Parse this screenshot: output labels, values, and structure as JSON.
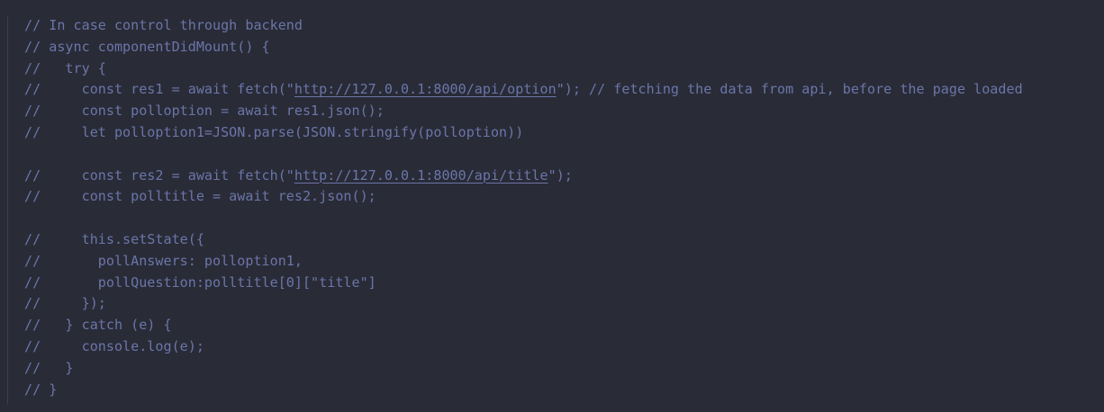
{
  "editor": {
    "lines": [
      {
        "before": "// In case control through backend",
        "url": "",
        "after": ""
      },
      {
        "before": "// async componentDidMount() {",
        "url": "",
        "after": ""
      },
      {
        "before": "//   try {",
        "url": "",
        "after": ""
      },
      {
        "before": "//     const res1 = await fetch(\"",
        "url": "http://127.0.0.1:8000/api/option",
        "after": "\"); // fetching the data from api, before the page loaded"
      },
      {
        "before": "//     const polloption = await res1.json();",
        "url": "",
        "after": ""
      },
      {
        "before": "//     let polloption1=JSON.parse(JSON.stringify(polloption))",
        "url": "",
        "after": ""
      },
      {
        "before": "",
        "url": "",
        "after": ""
      },
      {
        "before": "//     const res2 = await fetch(\"",
        "url": "http://127.0.0.1:8000/api/title",
        "after": "\");"
      },
      {
        "before": "//     const polltitle = await res2.json();",
        "url": "",
        "after": ""
      },
      {
        "before": "",
        "url": "",
        "after": ""
      },
      {
        "before": "//     this.setState({",
        "url": "",
        "after": ""
      },
      {
        "before": "//       pollAnswers: polloption1,",
        "url": "",
        "after": ""
      },
      {
        "before": "//       pollQuestion:polltitle[0][\"title\"]",
        "url": "",
        "after": ""
      },
      {
        "before": "//     });",
        "url": "",
        "after": ""
      },
      {
        "before": "//   } catch (e) {",
        "url": "",
        "after": ""
      },
      {
        "before": "//     console.log(e);",
        "url": "",
        "after": ""
      },
      {
        "before": "//   }",
        "url": "",
        "after": ""
      },
      {
        "before": "// }",
        "url": "",
        "after": ""
      }
    ]
  },
  "colors": {
    "background": "#292b37",
    "comment": "#6b76a8"
  }
}
